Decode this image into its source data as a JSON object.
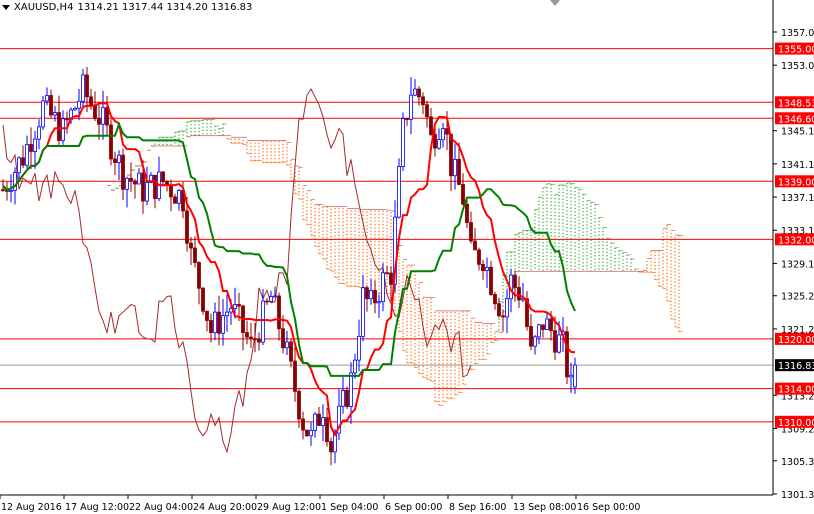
{
  "header": {
    "symbol": "XAUUSD,H4",
    "ohlc": "1314.21 1317.44 1314.20 1316.83"
  },
  "chart_data": {
    "type": "candlestick",
    "symbol": "XAUUSD",
    "timeframe": "H4",
    "indicators": [
      "Ichimoku Kinko Hyo"
    ],
    "ylim": [
      1301.3,
      1357.0
    ],
    "price_ticks": [
      "1357.00",
      "1353.00",
      "1345.10",
      "1341.10",
      "1337.10",
      "1333.10",
      "1329.10",
      "1325.20",
      "1321.20",
      "1313.20",
      "1309.20",
      "1305.30",
      "1301.30"
    ],
    "time_ticks": [
      "12 Aug 2016",
      "17 Aug 12:00",
      "22 Aug 04:00",
      "24 Aug 20:00",
      "29 Aug 12:00",
      "1 Sep 04:00",
      "6 Sep 00:00",
      "8 Sep 16:00",
      "13 Sep 08:00",
      "16 Sep 00:00"
    ],
    "levels": [
      {
        "value": 1355.0,
        "label": "1355.00",
        "color": "#ff0000"
      },
      {
        "value": 1348.53,
        "label": "1348.53",
        "color": "#ff0000"
      },
      {
        "value": 1346.6,
        "label": "1346.60",
        "color": "#ff0000"
      },
      {
        "value": 1339.0,
        "label": "1339.00",
        "color": "#ff0000"
      },
      {
        "value": 1332.0,
        "label": "1332.00",
        "color": "#ff0000"
      },
      {
        "value": 1320.0,
        "label": "1320.00",
        "color": "#ff0000"
      },
      {
        "value": 1314.0,
        "label": "1314.00",
        "color": "#ff0000"
      },
      {
        "value": 1310.0,
        "label": "1310.00",
        "color": "#ff0000"
      }
    ],
    "current_price": {
      "value": 1316.83,
      "label": "1316.83"
    },
    "close_keypoints": [
      [
        0,
        1338
      ],
      [
        5,
        1342
      ],
      [
        10,
        1348
      ],
      [
        15,
        1345
      ],
      [
        20,
        1350
      ],
      [
        25,
        1346
      ],
      [
        30,
        1340
      ],
      [
        35,
        1338
      ],
      [
        40,
        1339
      ],
      [
        45,
        1337
      ],
      [
        47,
        1330
      ],
      [
        50,
        1325
      ],
      [
        52,
        1321
      ],
      [
        57,
        1324
      ],
      [
        62,
        1319
      ],
      [
        67,
        1325
      ],
      [
        70,
        1320
      ],
      [
        72,
        1316
      ],
      [
        75,
        1310
      ],
      [
        77,
        1308
      ],
      [
        80,
        1312
      ],
      [
        82,
        1307
      ],
      [
        85,
        1312
      ],
      [
        87,
        1315
      ],
      [
        90,
        1325
      ],
      [
        92,
        1324
      ],
      [
        95,
        1327
      ],
      [
        97,
        1328
      ],
      [
        100,
        1345
      ],
      [
        102,
        1350
      ],
      [
        105,
        1349
      ],
      [
        107,
        1344
      ],
      [
        110,
        1347
      ],
      [
        112,
        1341
      ],
      [
        115,
        1337
      ],
      [
        117,
        1330
      ],
      [
        120,
        1330
      ],
      [
        122,
        1327
      ],
      [
        125,
        1323
      ],
      [
        127,
        1327
      ],
      [
        130,
        1325
      ],
      [
        132,
        1318
      ],
      [
        135,
        1322
      ],
      [
        137,
        1321
      ],
      [
        140,
        1319
      ],
      [
        142,
        1314
      ],
      [
        143,
        1316.83
      ]
    ],
    "colors": {
      "bull": "#0000ff",
      "bear": "#8b0000",
      "tenkan": "#ff0000",
      "kijun": "#008000",
      "chikou": "#a52a2a",
      "cloud_bear": "#ff6a00",
      "cloud_bull": "#2ea02e"
    }
  }
}
